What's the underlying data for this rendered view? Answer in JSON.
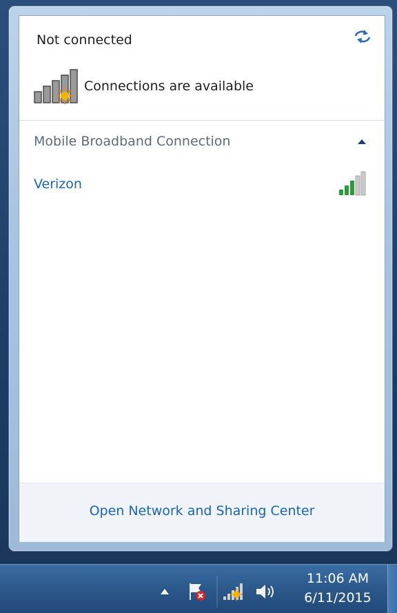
{
  "panel": {
    "title": "Not connected",
    "availability": "Connections are available",
    "refresh_icon": "refresh-icon",
    "status_icon": "signal-bars-sun-icon"
  },
  "section": {
    "label": "Mobile Broadband Connection",
    "collapse_icon": "chevron-up-icon"
  },
  "networks": [
    {
      "name": "Verizon",
      "signal_strength": "3 of 5 bars",
      "icon": "signal-strength-icon"
    }
  ],
  "footer": {
    "link": "Open Network and Sharing Center"
  },
  "taskbar": {
    "icons": [
      "show-hidden-icons-arrow",
      "action-center-flag-icon",
      "network-status-icon",
      "volume-icon"
    ],
    "time": "11:06 AM",
    "date": "6/11/2015"
  },
  "colors": {
    "link": "#1a63b8",
    "section_label": "#5b6b7c",
    "signal_green": "#2e9b3a",
    "taskbar": "#2c5a8d"
  }
}
